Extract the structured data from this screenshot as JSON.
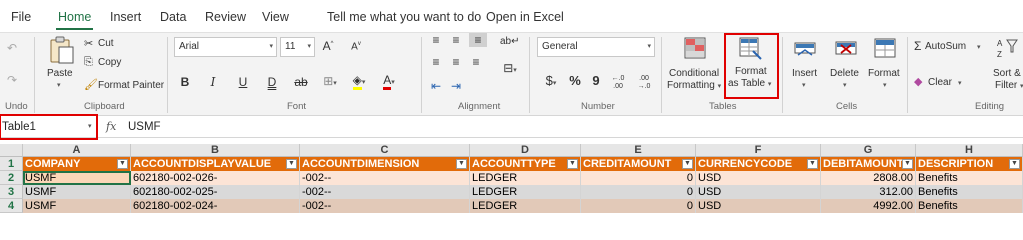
{
  "tabs": [
    "File",
    "Home",
    "Insert",
    "Data",
    "Review",
    "View",
    "Tell me what you want to do",
    "Open in Excel"
  ],
  "ribbon": {
    "undo": {
      "label": "Undo"
    },
    "clipboard": {
      "paste": "Paste",
      "cut": "Cut",
      "copy": "Copy",
      "format_painter": "Format Painter",
      "group": "Clipboard"
    },
    "font": {
      "name": "Arial",
      "size": "11",
      "grow": "A",
      "shrink": "A",
      "bold": "B",
      "italic": "I",
      "underline": "U",
      "double_underline": "D",
      "strike": "ab",
      "group": "Font"
    },
    "alignment": {
      "group": "Alignment"
    },
    "number": {
      "format": "General",
      "currency": "$",
      "percent": "%",
      "comma": "9",
      "group": "Number"
    },
    "tables": {
      "conditional_line1": "Conditional",
      "conditional_line2": "Formatting",
      "format_table_line1": "Format",
      "format_table_line2": "as Table",
      "group": "Tables"
    },
    "cells": {
      "insert": "Insert",
      "delete": "Delete",
      "format": "Format",
      "group": "Cells"
    },
    "editing": {
      "autosum": "AutoSum",
      "clear": "Clear",
      "sort_line1": "Sort &",
      "sort_line2": "Filter",
      "group": "Editing"
    }
  },
  "formula_bar": {
    "name_box": "Table1",
    "fx": "fx",
    "value": "USMF"
  },
  "grid": {
    "columns": [
      "A",
      "B",
      "C",
      "D",
      "E",
      "F",
      "G",
      "H"
    ],
    "row_numbers": [
      "1",
      "2",
      "3",
      "4"
    ],
    "headers": [
      "COMPANY",
      "ACCOUNTDISPLAYVALUE",
      "ACCOUNTDIMENSION",
      "ACCOUNTTYPE",
      "CREDITAMOUNT",
      "CURRENCYCODE",
      "DEBITAMOUNT",
      "DESCRIPTION"
    ],
    "rows": [
      [
        "USMF",
        "602180-002-026-",
        "-002--",
        "LEDGER",
        "0",
        "USD",
        "2808.00",
        "Benefits"
      ],
      [
        "USMF",
        "602180-002-025-",
        "-002--",
        "LEDGER",
        "0",
        "USD",
        "312.00",
        "Benefits"
      ],
      [
        "USMF",
        "602180-002-024-",
        "-002--",
        "LEDGER",
        "0",
        "USD",
        "4992.00",
        "Benefits"
      ]
    ]
  },
  "colors": {
    "accent": "#217346",
    "table_header": "#e26b0a",
    "highlight": "#e00000"
  }
}
